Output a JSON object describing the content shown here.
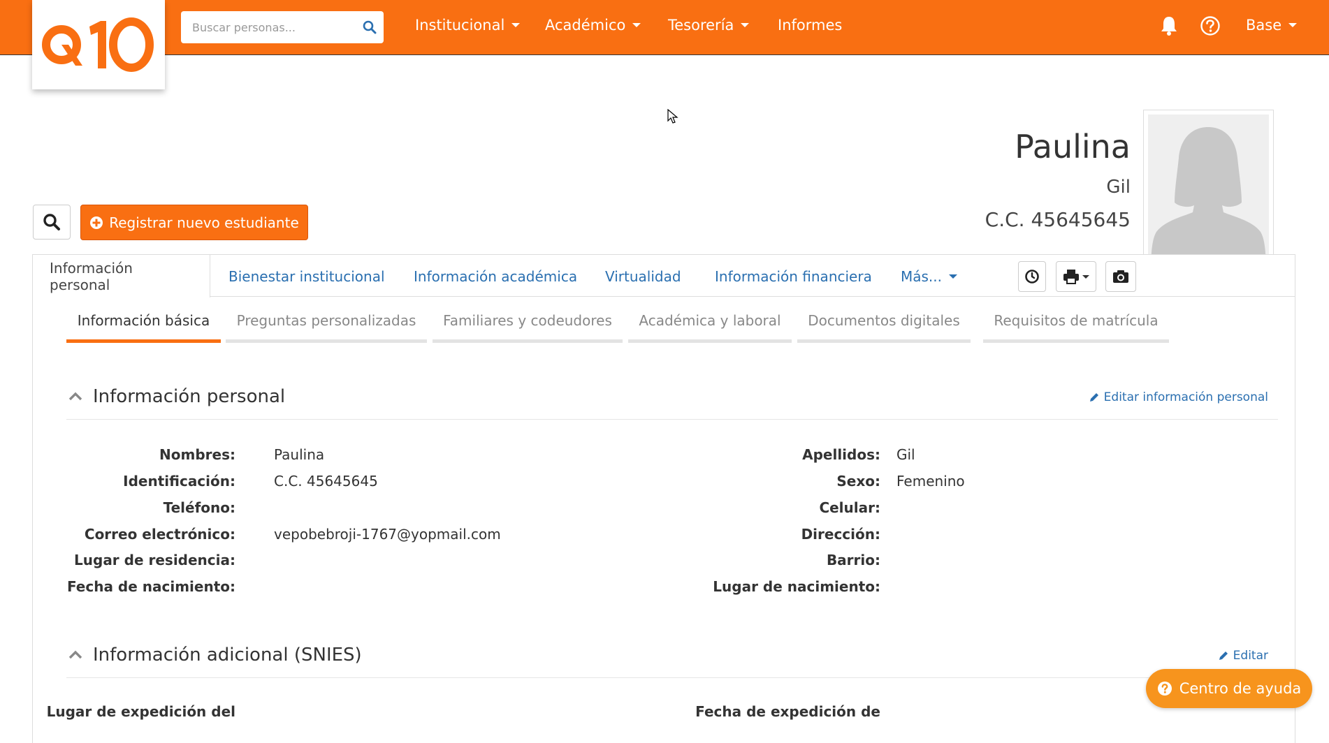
{
  "brand": {
    "logo_text": "Q10",
    "accent": "#f96f12"
  },
  "header": {
    "search_placeholder": "Buscar personas...",
    "nav": [
      {
        "label": "Institucional",
        "dropdown": true
      },
      {
        "label": "Académico",
        "dropdown": true
      },
      {
        "label": "Tesorería",
        "dropdown": true
      },
      {
        "label": "Informes",
        "dropdown": false
      }
    ],
    "icons": [
      "bell-icon",
      "help-circle-icon"
    ],
    "user_menu": "Base"
  },
  "student": {
    "first_name": "Paulina",
    "last_name": "Gil",
    "id": "C.C. 45645645"
  },
  "actions": {
    "register_label": "Registrar nuevo estudiante"
  },
  "tabs": [
    {
      "label": "Información personal",
      "active": true
    },
    {
      "label": "Bienestar institucional"
    },
    {
      "label": "Información académica"
    },
    {
      "label": "Virtualidad"
    },
    {
      "label": "Información financiera"
    },
    {
      "label": "Más...",
      "dropdown": true
    }
  ],
  "subtabs": [
    {
      "label": "Información básica",
      "active": true
    },
    {
      "label": "Preguntas personalizadas"
    },
    {
      "label": "Familiares y codeudores"
    },
    {
      "label": "Académica y laboral"
    },
    {
      "label": "Documentos digitales"
    },
    {
      "label": "Requisitos de matrícula"
    }
  ],
  "personal_section": {
    "title": "Información personal",
    "edit_label": "Editar información personal",
    "left_fields": [
      {
        "label": "Nombres:",
        "value": "Paulina"
      },
      {
        "label": "Identificación:",
        "value": "C.C. 45645645"
      },
      {
        "label": "Teléfono:",
        "value": ""
      },
      {
        "label": "Correo electrónico:",
        "value": "vepobebroji-1767@yopmail.com"
      },
      {
        "label": "Lugar de residencia:",
        "value": ""
      },
      {
        "label": "Fecha de nacimiento:",
        "value": ""
      }
    ],
    "right_fields": [
      {
        "label": "Apellidos:",
        "value": "Gil"
      },
      {
        "label": "Sexo:",
        "value": "Femenino"
      },
      {
        "label": "Celular:",
        "value": ""
      },
      {
        "label": "Dirección:",
        "value": ""
      },
      {
        "label": "Barrio:",
        "value": ""
      },
      {
        "label": "Lugar de nacimiento:",
        "value": ""
      }
    ]
  },
  "snies_section": {
    "title": "Información adicional (SNIES)",
    "edit_label": "Editar",
    "left_label": "Lugar de expedición del",
    "right_label": "Fecha de expedición de"
  },
  "help": {
    "label": "Centro de ayuda"
  }
}
